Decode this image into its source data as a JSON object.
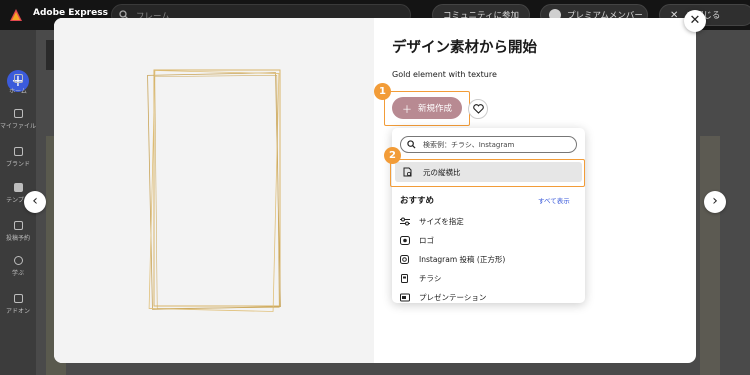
{
  "app": {
    "title": "Adobe Express",
    "search_placeholder": "フレーム",
    "community_label": "コミュニティに参加",
    "premium_label": "プレミアムメンバー",
    "close_label": "を閉じる"
  },
  "sidebar": {
    "items": [
      {
        "label": "ホーム",
        "icon": "home-icon"
      },
      {
        "label": "マイファイル",
        "icon": "folder-icon"
      },
      {
        "label": "ブランド",
        "icon": "brand-icon"
      },
      {
        "label": "テンプレ",
        "icon": "template-icon"
      },
      {
        "label": "投稿予約",
        "icon": "calendar-icon"
      },
      {
        "label": "学ぶ",
        "icon": "lightbulb-icon"
      },
      {
        "label": "アドオン",
        "icon": "addon-icon"
      }
    ]
  },
  "modal": {
    "title": "デザイン素材から開始",
    "template_name": "Gold element with texture",
    "create_label": "新規作成",
    "step1": "1",
    "step2": "2"
  },
  "dropdown": {
    "search_placeholder": "検索例：チラシ、Instagram",
    "aspect_label": "元の縦横比",
    "section_title": "おすすめ",
    "see_all": "すべて表示",
    "items": [
      {
        "label": "サイズを指定",
        "icon": "sliders-icon"
      },
      {
        "label": "ロゴ",
        "icon": "logo-icon"
      },
      {
        "label": "Instagram 投稿 (正方形)",
        "icon": "instagram-icon"
      },
      {
        "label": "チラシ",
        "icon": "flyer-icon"
      },
      {
        "label": "プレゼンテーション",
        "icon": "presentation-icon"
      }
    ]
  },
  "colors": {
    "accent": "#f29c38",
    "create_button": "#b88a92",
    "link": "#3b5bdb",
    "frame_gold": "#d9b66a"
  }
}
